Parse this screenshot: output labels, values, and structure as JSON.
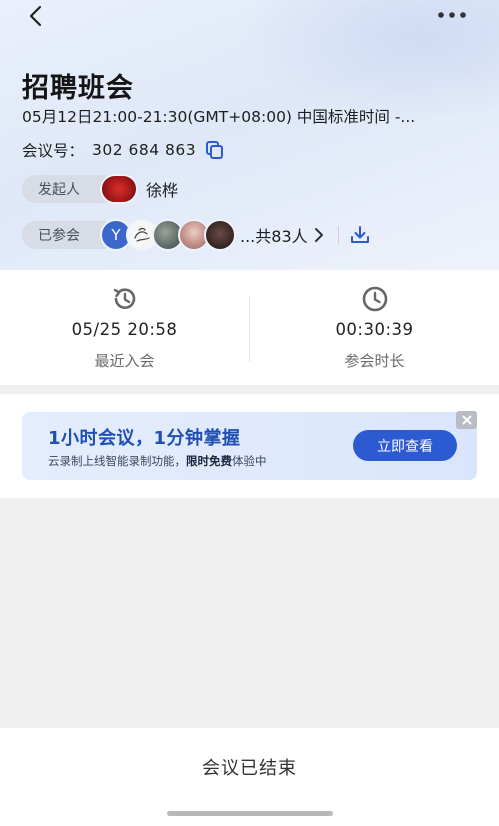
{
  "nav": {
    "back_icon": "chevron-left-icon",
    "more_icon": "more-dots-icon"
  },
  "meeting": {
    "title": "招聘班会",
    "time": "05月12日21:00-21:30(GMT+08:00) 中国标准时间 -...",
    "id_label": "会议号：",
    "id_value": "302 684 863",
    "host_label": "发起人",
    "host_name": "徐桦",
    "attendees_label": "已参会",
    "attendee_initial": "Y",
    "attendees_count": "...共83人"
  },
  "stats": {
    "last_join": {
      "value": "05/25 20:58",
      "label": "最近入会",
      "icon": "history-clock-icon"
    },
    "duration": {
      "value": "00:30:39",
      "label": "参会时长",
      "icon": "clock-icon"
    }
  },
  "banner": {
    "title": "1小时会议，1分钟掌握",
    "sub_prefix": "云录制上线智能录制功能，",
    "sub_bold": "限时免费",
    "sub_suffix": "体验中",
    "button": "立即查看"
  },
  "footer": {
    "status": "会议已结束"
  },
  "colors": {
    "accent": "#2c5ad0",
    "banner_title": "#1f4fb4",
    "header_bg": "#e4ecfa"
  }
}
